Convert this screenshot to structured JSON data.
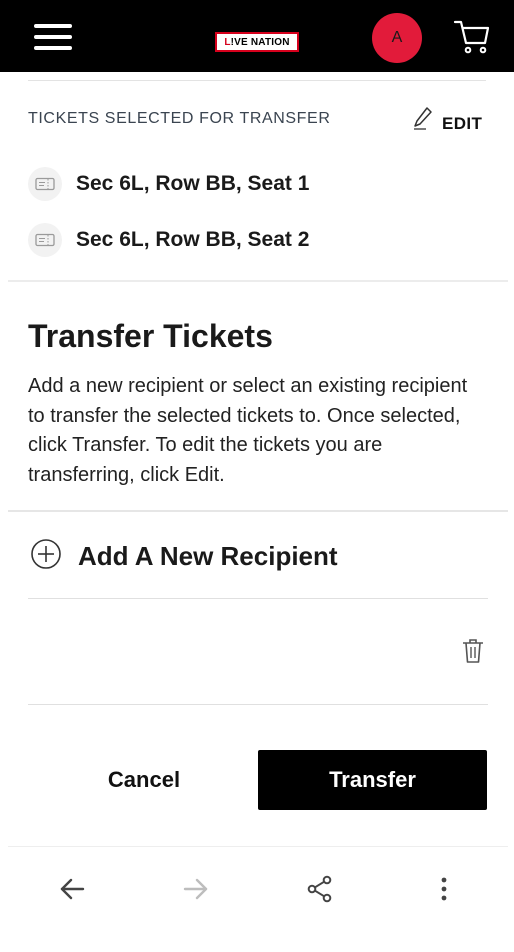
{
  "header": {
    "menu_icon": "hamburger-icon",
    "logo_text_a": "L",
    "logo_text_b": "!VE NATION",
    "avatar_initial": "A",
    "cart_icon": "cart-icon",
    "accent_color": "#e21b3a"
  },
  "selected": {
    "heading": "TICKETS SELECTED FOR TRANSFER",
    "edit_label": "EDIT",
    "tickets": [
      {
        "label": "Sec 6L, Row BB, Seat 1"
      },
      {
        "label": "Sec 6L, Row BB, Seat 2"
      }
    ]
  },
  "transfer": {
    "title": "Transfer Tickets",
    "description": "Add a new recipient or select an existing recipient to transfer the selected tickets to. Once selected, click Transfer. To edit the tickets you are transferring, click Edit."
  },
  "recipient": {
    "add_label": "Add A New Recipient"
  },
  "actions": {
    "cancel_label": "Cancel",
    "transfer_label": "Transfer"
  },
  "browser": {
    "icons": [
      "back-arrow-icon",
      "forward-arrow-icon",
      "share-icon",
      "more-vertical-icon"
    ]
  }
}
